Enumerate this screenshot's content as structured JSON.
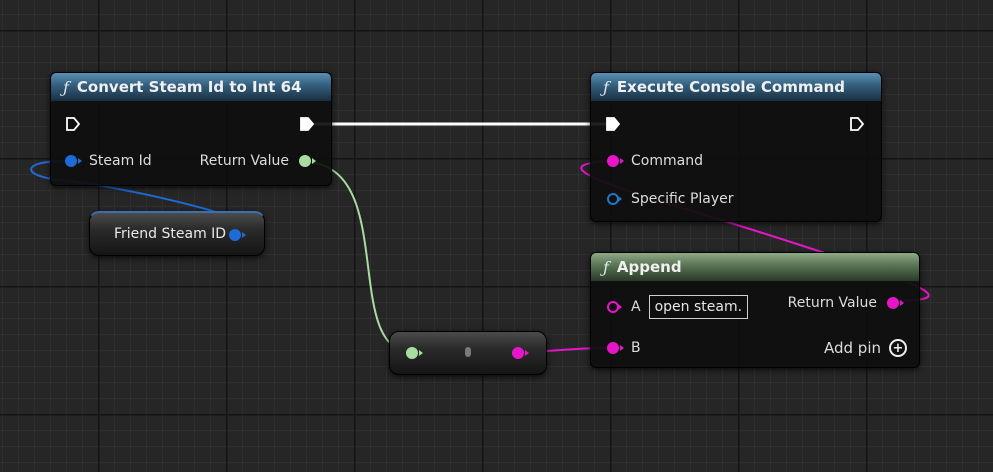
{
  "nodes": {
    "convert": {
      "title": "Convert Steam Id to Int 64",
      "input_label": "Steam Id",
      "output_label": "Return Value"
    },
    "execute": {
      "title": "Execute Console Command",
      "command_label": "Command",
      "player_label": "Specific Player"
    },
    "append": {
      "title": "Append",
      "a_label": "A",
      "a_value": "open steam.",
      "b_label": "B",
      "return_label": "Return Value",
      "add_pin_label": "Add pin"
    },
    "variable": {
      "label": "Friend Steam ID"
    }
  },
  "icons": {
    "function": "ƒ",
    "add": "+"
  },
  "colors": {
    "exec": "#ffffff",
    "steam_id": "#1e6ad6",
    "string": "#e616c8",
    "int64": "#a8dca0",
    "function_header": "#335e7c",
    "pure_header": "#587353"
  }
}
